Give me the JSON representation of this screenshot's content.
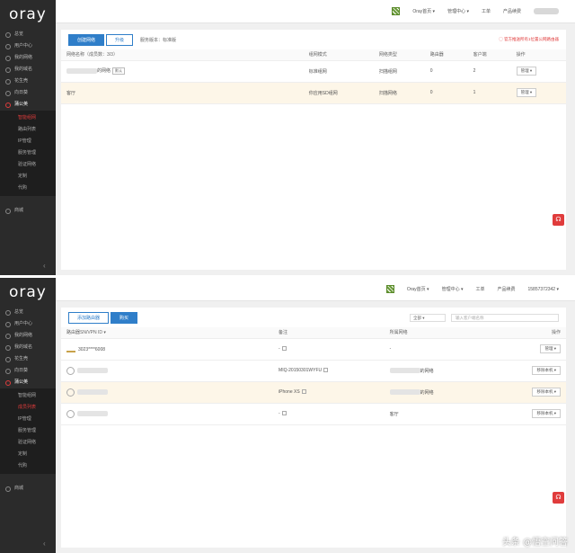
{
  "top": {
    "logo": "oray",
    "sidebar": {
      "items": [
        {
          "label": "总览"
        },
        {
          "label": "用户中心"
        },
        {
          "label": "我的网络"
        },
        {
          "label": "我的域名"
        },
        {
          "label": "花生壳"
        },
        {
          "label": "向日葵"
        },
        {
          "label": "蒲公英"
        }
      ],
      "sub": [
        {
          "label": "智能组网",
          "cur": true
        },
        {
          "label": "路由列表",
          "cur": false
        },
        {
          "label": "IP管理",
          "cur": false
        },
        {
          "label": "服务管理",
          "cur": false
        },
        {
          "label": "验证网络",
          "cur": false
        },
        {
          "label": "定制",
          "cur": false
        },
        {
          "label": "代购",
          "cur": false
        }
      ],
      "extra": "商城"
    },
    "header": {
      "links": [
        "Oray首页 ▾",
        "管理中心 ▾",
        "工单",
        "产品续费"
      ],
      "user": "••••••"
    },
    "toolbar": {
      "primary": "创建网络",
      "outline": "升级",
      "info": "服务版本：标准版",
      "note": "◯ 官方推送所有1位置公网路由器"
    },
    "table": {
      "headers": [
        "网络名称（成员数：3/3）",
        "",
        "组网模式",
        "网络类型",
        "路由器",
        "客户端",
        "操作"
      ],
      "rows": [
        {
          "name": "的网络",
          "tag": "默认",
          "mode": "标准组网",
          "type": "扫描组网",
          "router": "0",
          "client": "2",
          "op": "管理 ▾",
          "hl": false
        },
        {
          "name": "客厅",
          "tag": "",
          "mode": "你应用SD组网",
          "type": "扫描网络",
          "router": "0",
          "client": "1",
          "op": "管理 ▾",
          "hl": true
        }
      ]
    }
  },
  "bottom": {
    "logo": "oray",
    "sidebar": {
      "items": [
        {
          "label": "总览"
        },
        {
          "label": "用户中心"
        },
        {
          "label": "我的网络"
        },
        {
          "label": "我的域名"
        },
        {
          "label": "花生壳"
        },
        {
          "label": "向日葵"
        },
        {
          "label": "蒲公英"
        }
      ],
      "sub": [
        {
          "label": "智能组网",
          "cur": false
        },
        {
          "label": "成员列表",
          "cur": true
        },
        {
          "label": "IP管理",
          "cur": false
        },
        {
          "label": "服务管理",
          "cur": false
        },
        {
          "label": "验证网络",
          "cur": false
        },
        {
          "label": "定制",
          "cur": false
        },
        {
          "label": "代购",
          "cur": false
        }
      ],
      "extra": "商城"
    },
    "header": {
      "links": [
        "Oray首页 ▾",
        "管理中心 ▾",
        "工单",
        "产品续费"
      ],
      "user": "15857372342 ▾"
    },
    "toolbar": {
      "outline": "添加路由器",
      "primary": "购买",
      "select": "全部 ▾",
      "search": "输入客户端名称"
    },
    "table": {
      "headers": [
        "路由器SN/VPN ID ▾",
        "备注",
        "所属网络",
        "操作"
      ],
      "rows": [
        {
          "icon": "router",
          "name": "3023****6008",
          "note": "-",
          "net": "-",
          "op": "管理 ▾",
          "hl": false
        },
        {
          "icon": "user",
          "name": "",
          "note": "MIQ-20150301WYFU",
          "net": "的网络",
          "op": "移除本机 ▾",
          "hl": false
        },
        {
          "icon": "user",
          "name": "",
          "note": "iPhone XS",
          "net": "的网络",
          "op": "移除本机 ▾",
          "hl": true
        },
        {
          "icon": "user",
          "name": "",
          "note": "-",
          "net": "客厅",
          "op": "移除本机 ▾",
          "hl": false
        }
      ]
    },
    "watermark": "头条 @悟空问答"
  }
}
